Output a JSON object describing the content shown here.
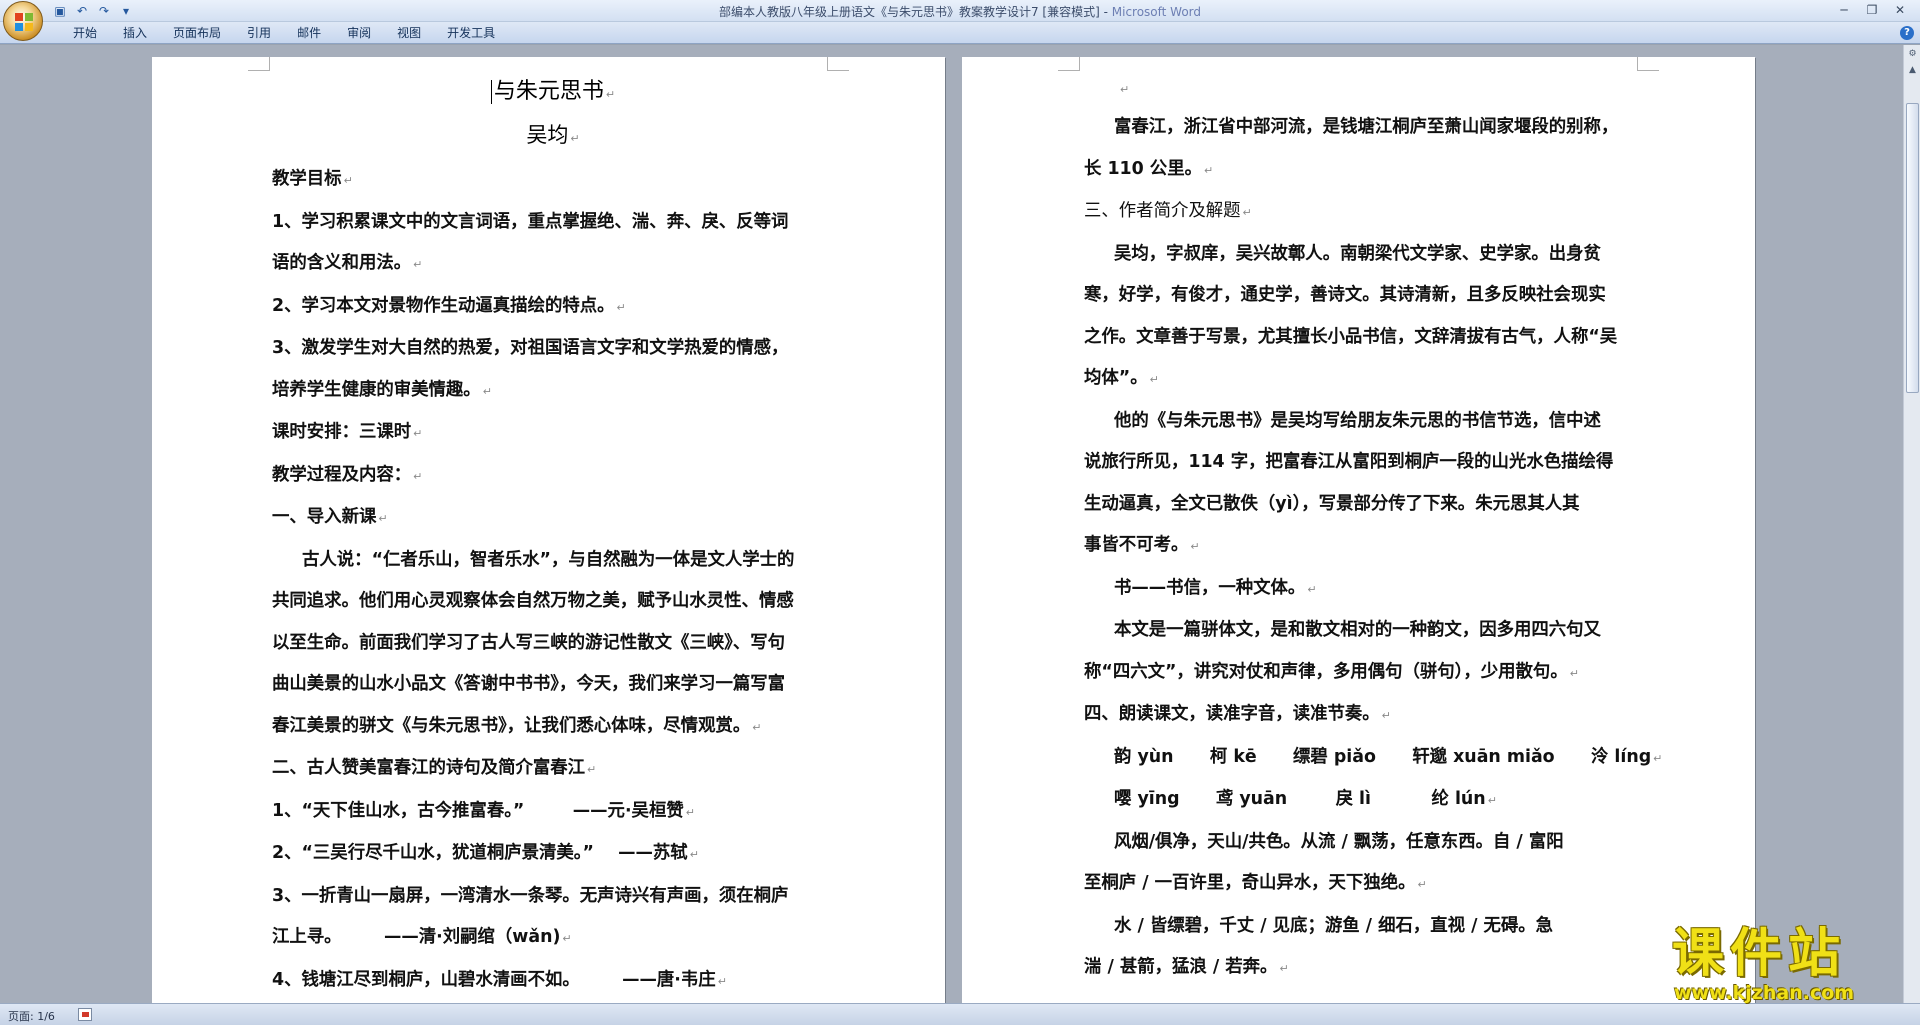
{
  "window": {
    "title": "部编本人教版八年级上册语文《与朱元思书》教案教学设计7 [兼容模式] - ",
    "app_name": "Microsoft Word"
  },
  "ribbon": {
    "tabs": [
      "开始",
      "插入",
      "页面布局",
      "引用",
      "邮件",
      "审阅",
      "视图",
      "开发工具"
    ]
  },
  "pilcrow": "↵",
  "page1": {
    "title": "与朱元思书",
    "author": "吴均",
    "lines": [
      "教学目标",
      "1、学习积累课文中的文言词语，重点掌握绝、湍、奔、戾、反等词",
      "语的含义和用法。",
      "2、学习本文对景物作生动逼真描绘的特点。",
      "3、激发学生对大自然的热爱，对祖国语言文字和文学热爱的情感，",
      "培养学生健康的审美情趣。",
      "课时安排：三课时",
      "教学过程及内容：",
      "一、导入新课",
      "古人说：“仁者乐山，智者乐水”，与自然融为一体是文人学士的",
      "共同追求。他们用心灵观察体会自然万物之美，赋予山水灵性、情感",
      "以至生命。前面我们学习了古人写三峡的游记性散文《三峡》、写句",
      "曲山美景的山水小品文《答谢中书书》，今天，我们来学习一篇写富",
      "春江美景的骈文《与朱元思书》，让我们悉心体味，尽情观赏。",
      "二、古人赞美富春江的诗句及简介富春江",
      "1、“天下佳山水，古今推富春。”        ——元·吴桓赞",
      "2、“三吴行尽千山水，犹道桐庐景清美。”    ——苏轼",
      "3、一折青山一扇屏，一湾清水一条琴。无声诗兴有声画，须在桐庐",
      "江上寻。       ——清·刘嗣绾（wǎn)",
      "4、钱塘江尽到桐庐，山碧水清画不如。       ——唐·韦庄"
    ]
  },
  "page2": {
    "lines": [
      "",
      "富春江，浙江省中部河流，是钱塘江桐庐至萧山闻家堰段的别称，",
      "长 110 公里。",
      "三、作者简介及解题",
      "吴均，字叔庠，吴兴故鄣人。南朝梁代文学家、史学家。出身贫",
      "寒，好学，有俊才，通史学，善诗文。其诗清新，且多反映社会现实",
      "之作。文章善于写景，尤其擅长小品书信，文辞清拔有古气，人称“吴",
      "均体”。",
      "他的《与朱元思书》是吴均写给朋友朱元思的书信节选，信中述",
      "说旅行所见，114 字，把富春江从富阳到桐庐一段的山光水色描绘得",
      "生动逼真，全文已散佚（yì），写景部分传了下来。朱元思其人其",
      "事皆不可考。",
      "书——书信，一种文体。",
      "本文是一篇骈体文，是和散文相对的一种韵文，因多用四六句又",
      "称“四六文”，讲究对仗和声律，多用偶句（骈句），少用散句。",
      "四、朗读课文，读准字音，读准节奏。",
      "韵 yùn      柯 kē      缥碧 piǎo      轩邈 xuān miǎo      泠 líng",
      "嘤 yīng      鸢 yuān        戾 lì          纶 lún",
      "风烟/俱净，天山/共色。从流 / 飘荡，任意东西。自 / 富阳",
      "至桐庐 / 一百许里，奇山异水，天下独绝。",
      "水 / 皆缥碧，千丈 / 见底；游鱼 / 细石，直视 / 无碍。急",
      "湍 / 甚箭，猛浪 / 若奔。"
    ]
  },
  "statusbar": {
    "page_count": "页面: 1/6"
  },
  "watermark": {
    "title": "课件站",
    "url": "www.kjzhan.com"
  }
}
